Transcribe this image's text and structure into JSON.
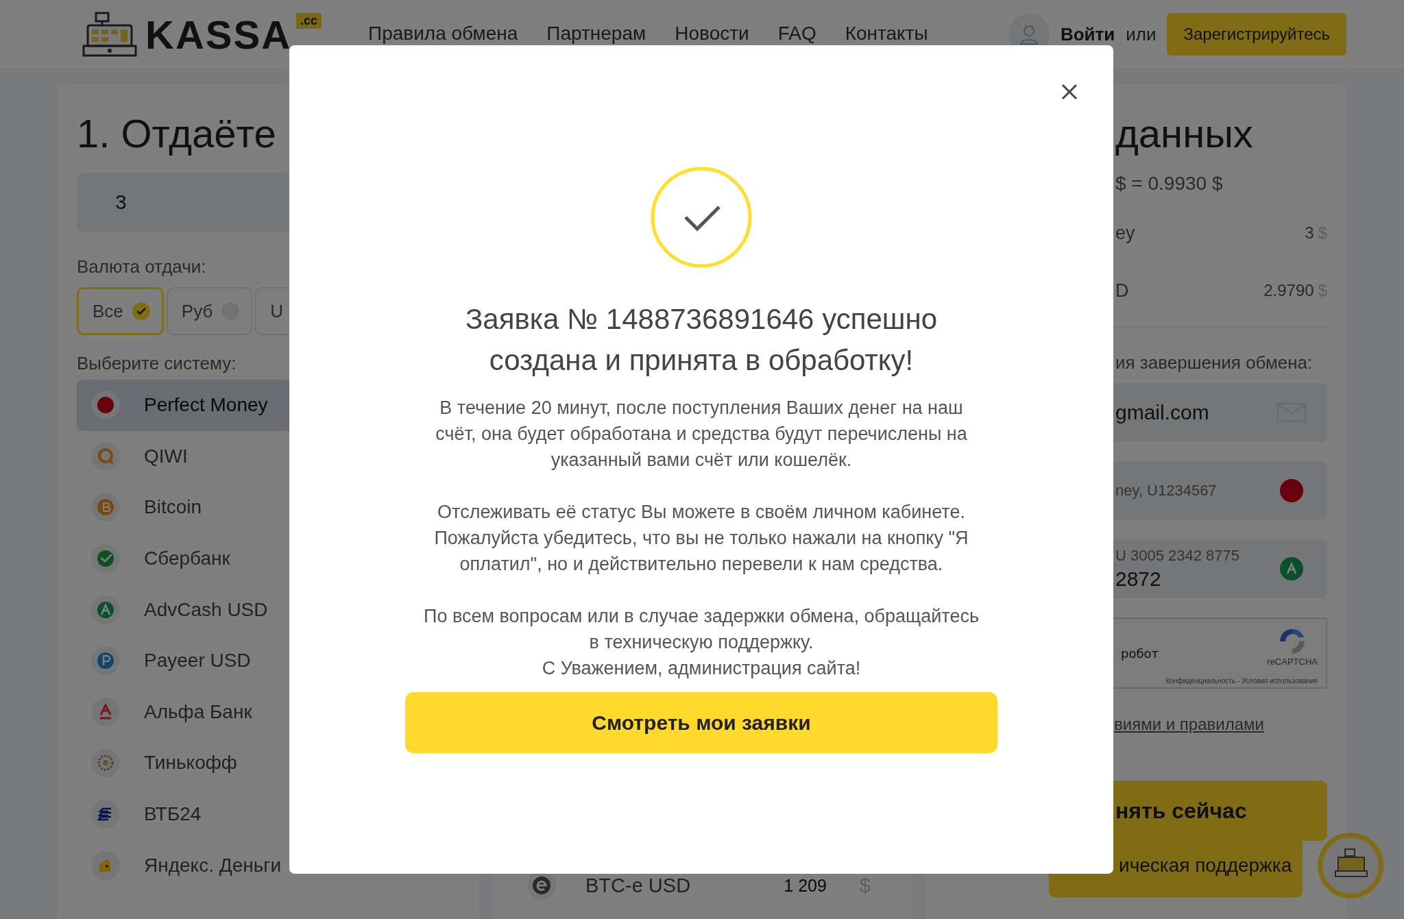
{
  "header": {
    "logo": {
      "text": "KASSA",
      "badge": ".cc"
    },
    "nav": [
      "Правила обмена",
      "Партнерам",
      "Новости",
      "FAQ",
      "Контакты"
    ],
    "login": "Войти",
    "or": "или",
    "register": "Зарегистрируйтесь"
  },
  "give_panel": {
    "title": "1. Отдаёте",
    "amount": "3",
    "currency_label": "Валюта отдачи:",
    "currencies": [
      {
        "label": "Все",
        "selected": true
      },
      {
        "label": "Руб",
        "selected": false
      },
      {
        "label": "U",
        "selected": false
      }
    ],
    "system_label": "Выберите систему:",
    "systems": [
      {
        "name": "Perfect Money",
        "kind": "pm",
        "selected": true
      },
      {
        "name": "QIWI",
        "kind": "qiwi",
        "selected": false
      },
      {
        "name": "Bitcoin",
        "kind": "btc",
        "selected": false
      },
      {
        "name": "Сбербанк",
        "kind": "sber",
        "selected": false
      },
      {
        "name": "AdvCash USD",
        "kind": "advcash",
        "selected": false
      },
      {
        "name": "Payeer USD",
        "kind": "payeer",
        "selected": false
      },
      {
        "name": "Альфа Банк",
        "kind": "alfa",
        "selected": false
      },
      {
        "name": "Тинькофф",
        "kind": "tinkoff",
        "selected": false
      },
      {
        "name": "ВТБ24",
        "kind": "vtb",
        "selected": false
      },
      {
        "name": "Яндекс. Деньги",
        "kind": "yandex",
        "selected": false
      }
    ]
  },
  "receive_panel": {
    "rows": [
      {
        "name": "BTC-e USD",
        "kind": "btce",
        "amount": "1 209",
        "currency": "$"
      }
    ]
  },
  "summary_panel": {
    "title": "данных",
    "rate": "$ = 0.9930 $",
    "lines": [
      {
        "label": "ey",
        "value": "3",
        "currency": "$"
      },
      {
        "label": "D",
        "value": "2.9790",
        "currency": "$"
      }
    ],
    "contacts_label": "ия завершения обмена:",
    "fields": [
      {
        "kind": "email",
        "value": "gmail.com"
      },
      {
        "kind": "pm",
        "label": "ney, U1234567"
      },
      {
        "kind": "advcash",
        "label": "U 3005 2342 8775",
        "value": "2872"
      }
    ],
    "captcha": {
      "label": "робот",
      "brand": "reCAPTCHA",
      "links": "Конфиденциальность - Условия использования"
    },
    "terms_link": "виями и правилами",
    "submit": "нять сейчас"
  },
  "support": {
    "label": "ическая поддержка"
  },
  "modal": {
    "title": "Заявка № 1488736891646 успешно создана и принята в обработку!",
    "blocks": [
      [
        "В течение 20 минут, после поступления Ваших денег на наш счёт, она будет обработана и средства будут перечислены на указанный вами счёт или кошелёк."
      ],
      [
        "Отслеживать её статус Вы можете в своём личном кабинете. Пожалуйста убедитесь, что вы не только нажали на кнопку \"Я оплатил\", но и действительно перевели к нам средства."
      ],
      [
        "По всем вопросам или в случае задержки обмена, обращайтесь в техническую поддержку.",
        "С Уважением, администрация сайта!"
      ]
    ],
    "button": "Смотреть мои заявки"
  }
}
